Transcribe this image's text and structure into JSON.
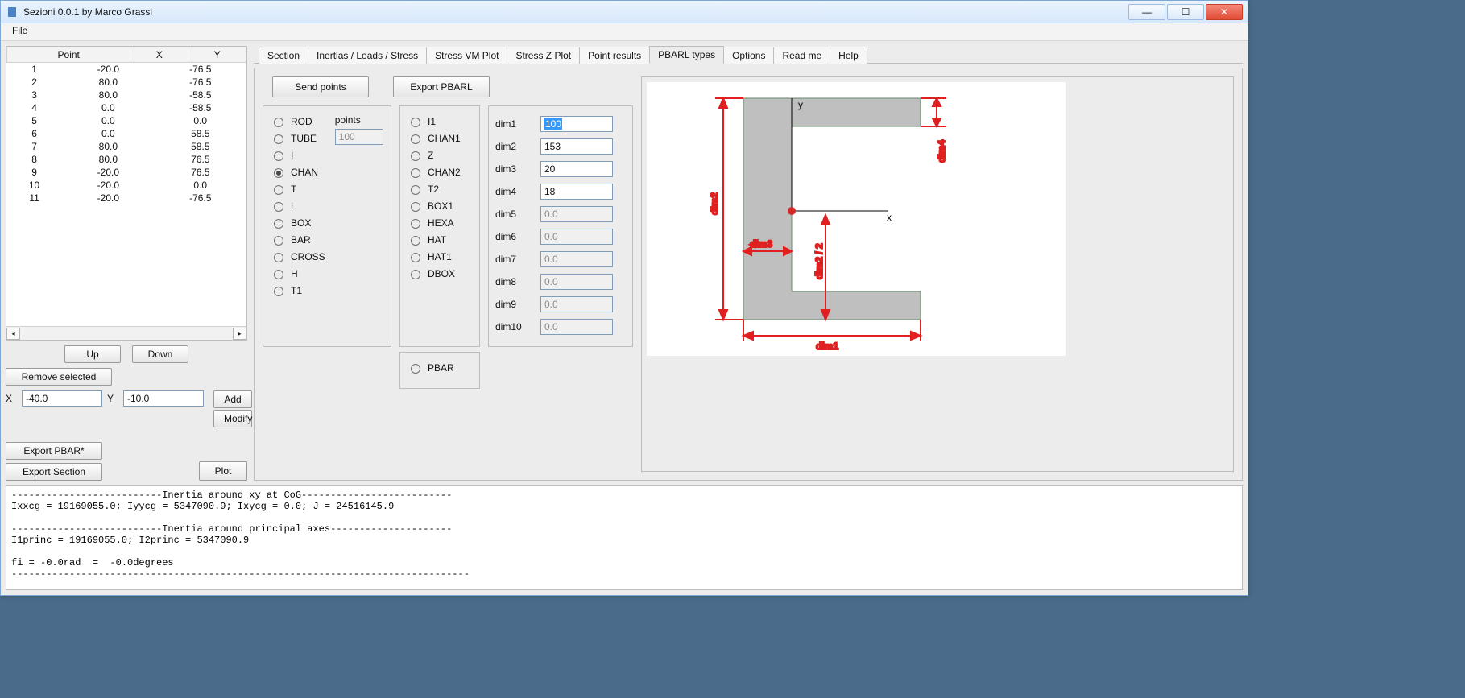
{
  "window": {
    "title": "Sezioni 0.0.1 by Marco Grassi"
  },
  "menubar": {
    "file": "File"
  },
  "win_btns": {
    "min": "—",
    "max": "☐",
    "close": "✕"
  },
  "points_table": {
    "headers": [
      "Point",
      "X",
      "Y"
    ],
    "rows": [
      [
        "1",
        "-20.0",
        "-76.5"
      ],
      [
        "2",
        "80.0",
        "-76.5"
      ],
      [
        "3",
        "80.0",
        "-58.5"
      ],
      [
        "4",
        "0.0",
        "-58.5"
      ],
      [
        "5",
        "0.0",
        "0.0"
      ],
      [
        "6",
        "0.0",
        "58.5"
      ],
      [
        "7",
        "80.0",
        "58.5"
      ],
      [
        "8",
        "80.0",
        "76.5"
      ],
      [
        "9",
        "-20.0",
        "76.5"
      ],
      [
        "10",
        "-20.0",
        "0.0"
      ],
      [
        "11",
        "-20.0",
        "-76.5"
      ]
    ]
  },
  "left_buttons": {
    "up": "Up",
    "down": "Down",
    "remove": "Remove selected",
    "add": "Add",
    "modify": "Modify",
    "export_pbar": "Export PBAR*",
    "export_section": "Export Section",
    "plot": "Plot",
    "X": "X",
    "Y": "Y",
    "x_val": "-40.0",
    "y_val": "-10.0"
  },
  "tabs": {
    "items": [
      "Section",
      "Inertias / Loads / Stress",
      "Stress VM Plot",
      "Stress Z Plot",
      "Point results",
      "PBARL types",
      "Options",
      "Read me",
      "Help"
    ],
    "active_index": 5
  },
  "pbarl": {
    "send_points": "Send points",
    "export_pbarl": "Export PBARL",
    "points_label": "points",
    "points_value": "100",
    "radios_col1": [
      "ROD",
      "TUBE",
      "I",
      "CHAN",
      "T",
      "L",
      "BOX",
      "BAR",
      "CROSS",
      "H",
      "T1"
    ],
    "radios_col2": [
      "I1",
      "CHAN1",
      "Z",
      "CHAN2",
      "T2",
      "BOX1",
      "HEXA",
      "HAT",
      "HAT1",
      "DBOX"
    ],
    "radio_pbar": "PBAR",
    "radios_col1_selected": 3,
    "dims": [
      {
        "label": "dim1",
        "value": "100",
        "enabled": true,
        "selected": true
      },
      {
        "label": "dim2",
        "value": "153",
        "enabled": true
      },
      {
        "label": "dim3",
        "value": "20",
        "enabled": true
      },
      {
        "label": "dim4",
        "value": "18",
        "enabled": true
      },
      {
        "label": "dim5",
        "value": "0.0",
        "enabled": false
      },
      {
        "label": "dim6",
        "value": "0.0",
        "enabled": false
      },
      {
        "label": "dim7",
        "value": "0.0",
        "enabled": false
      },
      {
        "label": "dim8",
        "value": "0.0",
        "enabled": false
      },
      {
        "label": "dim9",
        "value": "0.0",
        "enabled": false
      },
      {
        "label": "dim10",
        "value": "0.0",
        "enabled": false
      }
    ]
  },
  "diagram": {
    "labels": {
      "y": "y",
      "x": "x",
      "dim1": "dim1",
      "dim2": "dim2",
      "dim3": "dim3",
      "dim4": "dim4",
      "dim2_2": "dim2 / 2"
    }
  },
  "console_text": "--------------------------Inertia around xy at CoG--------------------------\nIxxcg = 19169055.0; Iyycg = 5347090.9; Ixycg = 0.0; J = 24516145.9\n\n--------------------------Inertia around principal axes---------------------\nI1princ = 19169055.0; I2princ = 5347090.9\n\nfi = -0.0rad  =  -0.0degrees\n-------------------------------------------------------------------------------"
}
